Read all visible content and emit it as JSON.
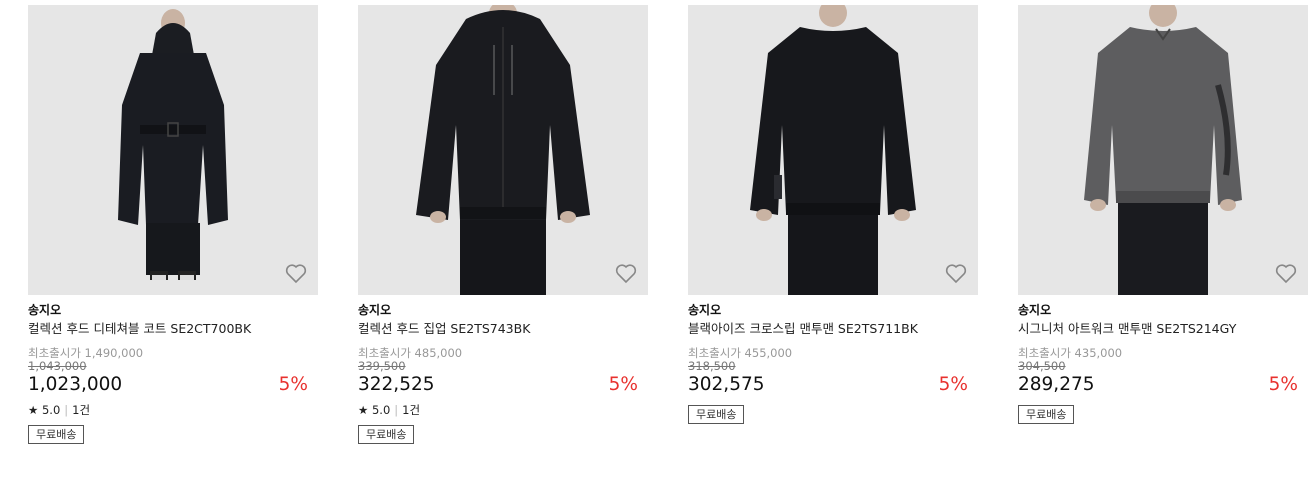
{
  "colors": {
    "discount": "#e8312e",
    "thumb_bg": "#e6e6e6"
  },
  "products": [
    {
      "brand": "송지오",
      "name": "컬렉션 후드 디테쳐블 코트 SE2CT700BK",
      "original_price": "최초출시가 1,490,000",
      "list_price": "1,043,000",
      "price": "1,023,000",
      "discount": "5%",
      "rating": "5.0",
      "reviews": "1건",
      "shipping": "무료배송",
      "icon": "heart-outline-icon"
    },
    {
      "brand": "송지오",
      "name": "컬렉션 후드 집업 SE2TS743BK",
      "original_price": "최초출시가 485,000",
      "list_price": "339,500",
      "price": "322,525",
      "discount": "5%",
      "rating": "5.0",
      "reviews": "1건",
      "shipping": "무료배송",
      "icon": "heart-outline-icon"
    },
    {
      "brand": "송지오",
      "name": "블랙아이즈 크로스립 맨투맨 SE2TS711BK",
      "original_price": "최초출시가 455,000",
      "list_price": "318,500",
      "price": "302,575",
      "discount": "5%",
      "shipping": "무료배송",
      "icon": "heart-outline-icon"
    },
    {
      "brand": "송지오",
      "name": "시그니처 아트워크 맨투맨 SE2TS214GY",
      "original_price": "최초출시가 435,000",
      "list_price": "304,500",
      "price": "289,275",
      "discount": "5%",
      "shipping": "무료배송",
      "icon": "heart-outline-icon"
    }
  ]
}
